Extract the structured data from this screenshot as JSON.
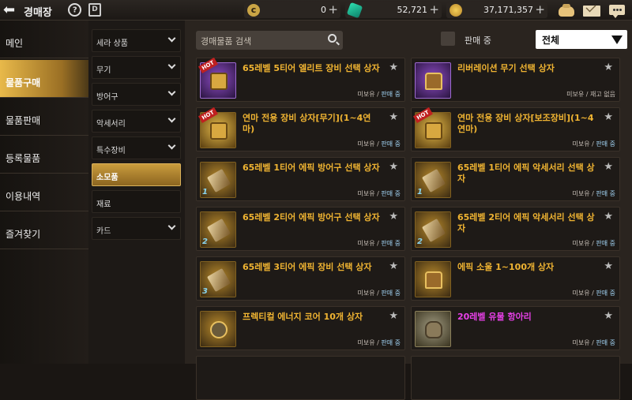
{
  "topbar": {
    "title": "경매장",
    "help": "?",
    "d_button": "D",
    "currency1": {
      "icon": "gold-c-coin-icon",
      "value": "0"
    },
    "currency2": {
      "icon": "green-gem-icon",
      "value": "52,721"
    },
    "currency3": {
      "icon": "gold-coin-icon",
      "value": "37,171,357"
    },
    "plus": "+"
  },
  "leftnav": [
    {
      "label": "메인"
    },
    {
      "label": "물품구매",
      "active": true
    },
    {
      "label": "물품판매"
    },
    {
      "label": "등록물품"
    },
    {
      "label": "이용내역"
    },
    {
      "label": "즐겨찾기"
    }
  ],
  "categories": [
    {
      "label": "세라 상품",
      "chevron": true
    },
    {
      "label": "무기",
      "chevron": true
    },
    {
      "label": "방어구",
      "chevron": true
    },
    {
      "label": "악세서리",
      "chevron": true
    },
    {
      "label": "특수장비",
      "chevron": true
    },
    {
      "label": "소모품",
      "active": true
    },
    {
      "label": "재료"
    },
    {
      "label": "카드",
      "chevron": true
    }
  ],
  "search": {
    "placeholder": "경매물품 검색"
  },
  "filter": {
    "on_sale_label": "판매 중",
    "dropdown_value": "전체"
  },
  "items": [
    {
      "name": "65레벨 5티어 엘리트 장비 선택 상자",
      "hot": true,
      "thumb": "purple",
      "own": "미보유",
      "sep": "/",
      "status": "판매 중"
    },
    {
      "name": "리버레이션 무기 선택 상자",
      "thumb": "purple",
      "own": "미보유",
      "sep": "/",
      "status": "재고 없음"
    },
    {
      "name": "연마 전용 장비 상자[무기](1~4연마)",
      "hot": true,
      "thumb": "gold",
      "own": "미보유",
      "sep": "/",
      "status": "판매 중"
    },
    {
      "name": "연마 전용 장비 상자[보조장비](1~4연마)",
      "hot": true,
      "thumb": "gold",
      "own": "미보유",
      "sep": "/",
      "status": "판매 중"
    },
    {
      "name": "65레벨 1티어 에픽 방어구 선택 상자",
      "tier": "1",
      "own": "미보유",
      "sep": "/",
      "status": "판매 중"
    },
    {
      "name": "65레벨 1티어 에픽 악세서리 선택 상자",
      "tier": "1",
      "own": "미보유",
      "sep": "/",
      "status": "판매 중"
    },
    {
      "name": "65레벨 2티어 에픽 방어구 선택 상자",
      "tier": "2",
      "own": "미보유",
      "sep": "/",
      "status": "판매 중"
    },
    {
      "name": "65레벨 2티어 에픽 악세서리 선택 상자",
      "tier": "2",
      "own": "미보유",
      "sep": "/",
      "status": "판매 중"
    },
    {
      "name": "65레벨 3티어 에픽 장비 선택 상자",
      "tier": "3",
      "own": "미보유",
      "sep": "/",
      "status": "판매 중"
    },
    {
      "name": "에픽 소울 1~100개 상자",
      "own": "미보유",
      "sep": "/",
      "status": "판매 중"
    },
    {
      "name": "프렉티컬 에너지 코어 10개 상자",
      "own": "미보유",
      "sep": "/",
      "status": "판매 중"
    },
    {
      "name": "20레벨 유물 항아리",
      "magenta": true,
      "thumb": "stone",
      "own": "미보유",
      "sep": "/",
      "status": "판매 중"
    }
  ]
}
